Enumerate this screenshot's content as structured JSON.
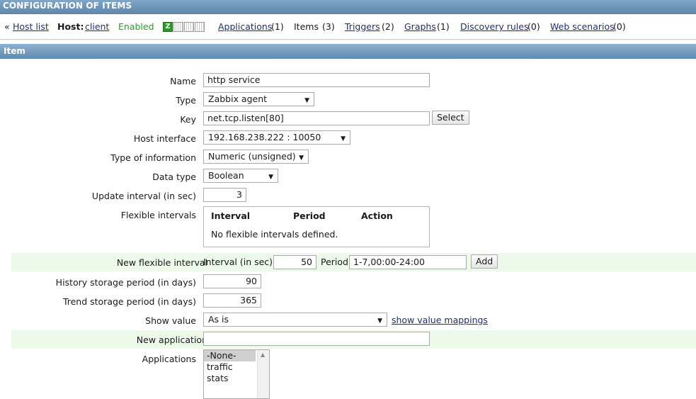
{
  "header": {
    "title": "CONFIGURATION OF ITEMS"
  },
  "nav": {
    "back_prefix": "«",
    "host_list": "Host list",
    "host_label": "Host:",
    "host_name": "client",
    "status": "Enabled",
    "status_icon_letter": "Z",
    "links": [
      {
        "label": "Applications",
        "count": "(1)"
      },
      {
        "label": "Items",
        "count": "(3)"
      },
      {
        "label": "Triggers",
        "count": "(2)"
      },
      {
        "label": "Graphs",
        "count": "(1)"
      },
      {
        "label": "Discovery rules",
        "count": "(0)"
      },
      {
        "label": "Web scenarios",
        "count": "(0)"
      }
    ]
  },
  "section": {
    "title": "Item"
  },
  "form": {
    "name": {
      "label": "Name",
      "value": "http service"
    },
    "type": {
      "label": "Type",
      "value": "Zabbix agent"
    },
    "key": {
      "label": "Key",
      "value": "net.tcp.listen[80]",
      "button": "Select"
    },
    "host_interface": {
      "label": "Host interface",
      "value": "192.168.238.222 : 10050"
    },
    "type_of_information": {
      "label": "Type of information",
      "value": "Numeric (unsigned)"
    },
    "data_type": {
      "label": "Data type",
      "value": "Boolean"
    },
    "update_interval": {
      "label": "Update interval (in sec)",
      "value": "3"
    },
    "flexible_intervals": {
      "label": "Flexible intervals",
      "columns": [
        "Interval",
        "Period",
        "Action"
      ],
      "empty_text": "No flexible intervals defined."
    },
    "new_flexible_interval": {
      "label": "New flexible interval",
      "interval_label": "Interval (in sec)",
      "interval_value": "50",
      "period_label": "Period",
      "period_value": "1-7,00:00-24:00",
      "button": "Add"
    },
    "history": {
      "label": "History storage period (in days)",
      "value": "90"
    },
    "trends": {
      "label": "Trend storage period (in days)",
      "value": "365"
    },
    "show_value": {
      "label": "Show value",
      "value": "As is",
      "link": "show value mappings"
    },
    "new_application": {
      "label": "New application",
      "value": ""
    },
    "applications": {
      "label": "Applications",
      "options": [
        "-None-",
        "traffic stats"
      ]
    }
  },
  "colors": {
    "header_bar": "#5d86ab",
    "link": "#1f2f6b",
    "enabled_green": "#2b9a2b",
    "highlight_row": "#eefae9"
  },
  "icons": {
    "dropdown_arrow": "▼",
    "scroll_up": "▲"
  }
}
